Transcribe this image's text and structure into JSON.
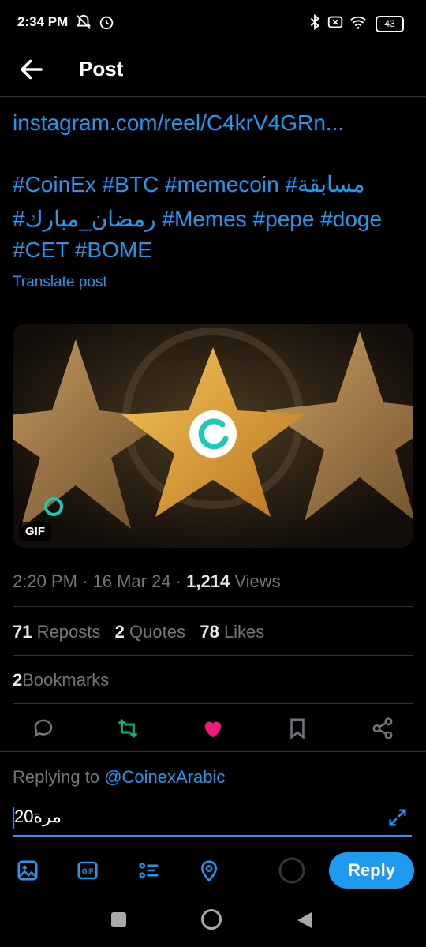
{
  "status_bar": {
    "time": "2:34 PM",
    "battery": "43"
  },
  "header": {
    "title": "Post"
  },
  "post": {
    "link_text": "instagram.com/reel/C4krV4GRn...",
    "hashtags_line1": " #CoinEx #BTC #memecoin #مسابقة",
    "hashtags_line2": "#رمضان_مبارك  #Memes #pepe  #doge",
    "hashtags_line3": "#CET  #BOME",
    "translate_label": "Translate post",
    "media_badge": "GIF",
    "time": "2:20 PM",
    "date": "16 Mar 24",
    "separator": "·",
    "views_count": "1,214",
    "views_label": "Views"
  },
  "stats": {
    "reposts_count": "71",
    "reposts_label": "Reposts",
    "quotes_count": "2",
    "quotes_label": "Quotes",
    "likes_count": "78",
    "likes_label": "Likes",
    "bookmarks_count": "2",
    "bookmarks_label": "Bookmarks"
  },
  "actions": [
    "reply-icon",
    "repost-icon",
    "like-icon",
    "bookmark-icon",
    "share-icon"
  ],
  "reply_box": {
    "replying_to_label": "Replying to",
    "replying_to_handle": "@CoinexArabic",
    "input_value": "20مرة",
    "reply_button": "Reply"
  },
  "colors": {
    "accent": "#1d9bf0",
    "repost_active": "#00ba7c",
    "like_active": "#f91880"
  }
}
